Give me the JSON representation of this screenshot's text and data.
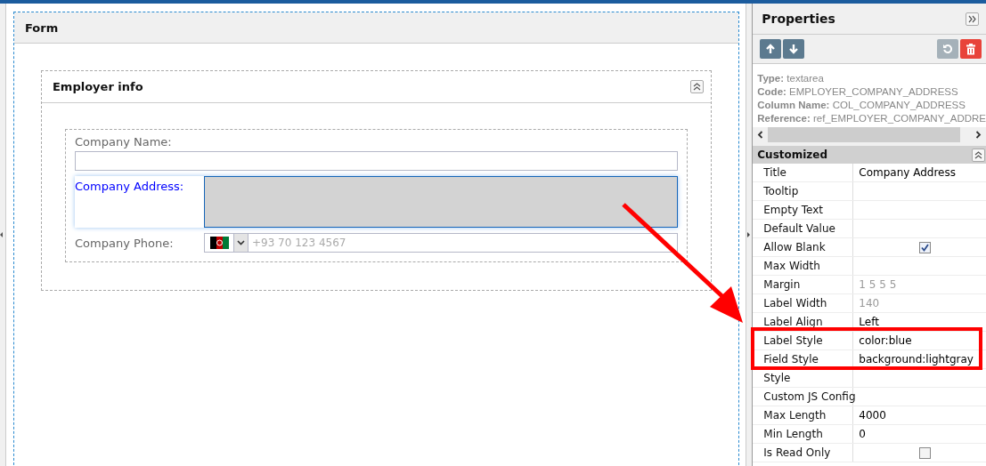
{
  "form": {
    "title": "Form",
    "section": {
      "title": "Employer info",
      "fields": [
        {
          "kind": "text",
          "label": "Company Name:",
          "focused": false
        },
        {
          "kind": "textarea",
          "label": "Company Address:",
          "focused": true
        },
        {
          "kind": "phone",
          "label": "Company Phone:",
          "placeholder": "+93 70 123 4567",
          "focused": false
        }
      ]
    }
  },
  "properties": {
    "title": "Properties",
    "info": [
      {
        "key": "Type:",
        "value": "textarea"
      },
      {
        "key": "Code:",
        "value": "EMPLOYER_COMPANY_ADDRESS"
      },
      {
        "key": "Column Name:",
        "value": "COL_COMPANY_ADDRESS"
      },
      {
        "key": "Reference:",
        "value": "ref_EMPLOYER_COMPANY_ADDRE"
      }
    ],
    "group": "Customized",
    "rows": [
      {
        "kind": "text",
        "name": "Title",
        "value": "Company Address",
        "disabled": false
      },
      {
        "kind": "text",
        "name": "Tooltip"
      },
      {
        "kind": "text",
        "name": "Empty Text"
      },
      {
        "kind": "text",
        "name": "Default Value"
      },
      {
        "kind": "check",
        "name": "Allow Blank",
        "checked": true
      },
      {
        "kind": "text",
        "name": "Max Width"
      },
      {
        "kind": "text",
        "name": "Margin",
        "value": "1 5 5 5",
        "disabled": true
      },
      {
        "kind": "text",
        "name": "Label Width",
        "value": "140",
        "disabled": true
      },
      {
        "kind": "text",
        "name": "Label Align",
        "value": "Left",
        "disabled": false
      },
      {
        "kind": "text",
        "name": "Label Style",
        "value": "color:blue",
        "disabled": false
      },
      {
        "kind": "text",
        "name": "Field Style",
        "value": "background:lightgray",
        "disabled": false
      },
      {
        "kind": "text",
        "name": "Style"
      },
      {
        "kind": "text",
        "name": "Custom JS Config"
      },
      {
        "kind": "text",
        "name": "Max Length",
        "value": "4000",
        "disabled": false
      },
      {
        "kind": "text",
        "name": "Min Length",
        "value": "0",
        "disabled": false
      },
      {
        "kind": "check",
        "name": "Is Read Only",
        "checked": false
      }
    ]
  }
}
